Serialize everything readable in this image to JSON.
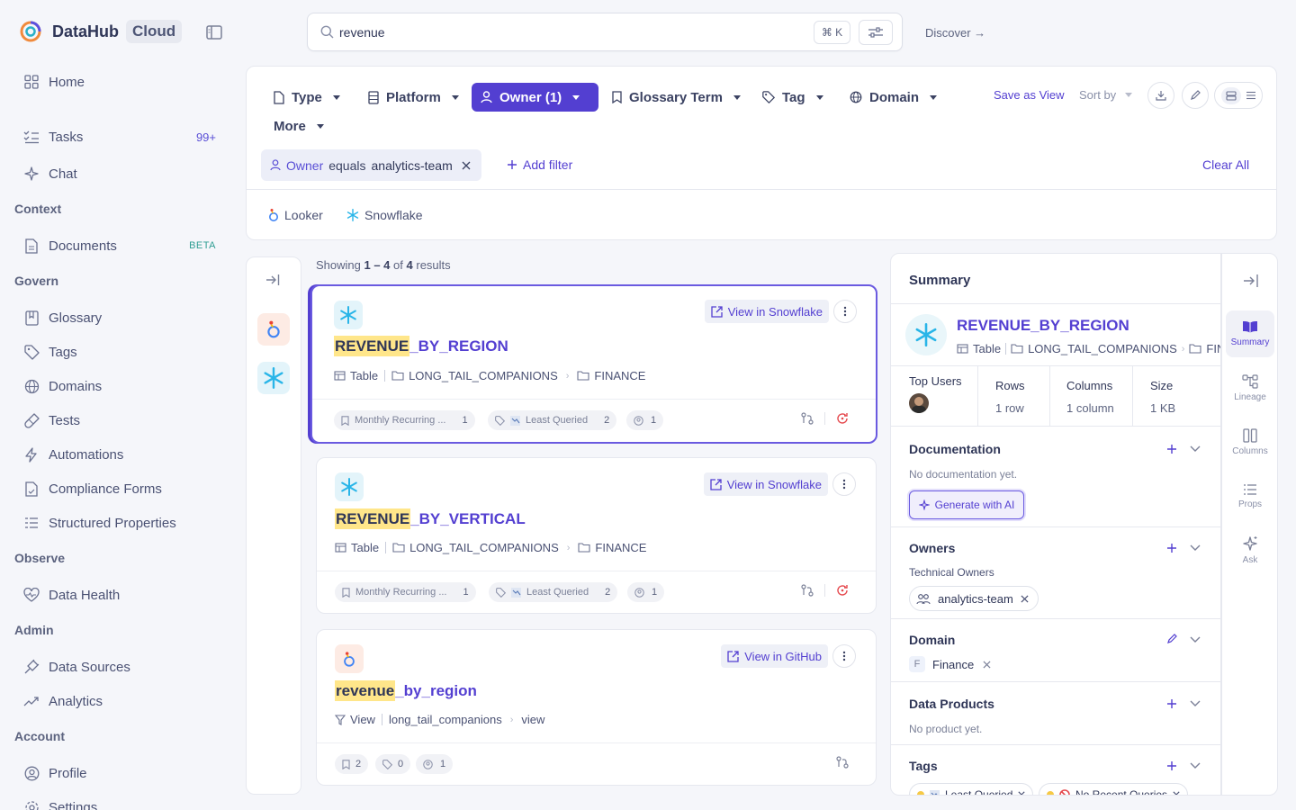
{
  "brand": {
    "name": "DataHub",
    "edition": "Cloud"
  },
  "nav": {
    "home": "Home",
    "tasks": "Tasks",
    "tasks_badge": "99+",
    "chat": "Chat",
    "context_section": "Context",
    "documents": "Documents",
    "documents_badge": "BETA",
    "govern_section": "Govern",
    "glossary": "Glossary",
    "tags": "Tags",
    "domains": "Domains",
    "tests": "Tests",
    "automations": "Automations",
    "compliance_forms": "Compliance Forms",
    "structured_properties": "Structured Properties",
    "observe_section": "Observe",
    "data_health": "Data Health",
    "admin_section": "Admin",
    "data_sources": "Data Sources",
    "analytics": "Analytics",
    "account_section": "Account",
    "profile": "Profile",
    "settings": "Settings"
  },
  "search": {
    "query": "revenue",
    "shortcut": "⌘ K"
  },
  "discover": "Discover →",
  "filters": {
    "type": "Type",
    "platform": "Platform",
    "owner": "Owner (1)",
    "glossary_term": "Glossary Term",
    "tag": "Tag",
    "domain": "Domain",
    "more": "More",
    "save_as_view": "Save as View",
    "sort_by": "Sort by",
    "active_filter": {
      "key": "Owner",
      "op": "equals",
      "value": "analytics-team"
    },
    "add_filter": "Add filter",
    "clear_all": "Clear All",
    "quick_platforms": [
      "Looker",
      "Snowflake"
    ]
  },
  "results": {
    "showing_prefix": "Showing",
    "range": "1 – 4",
    "of": "of",
    "total": "4",
    "suffix": "results",
    "items": [
      {
        "title_highlight": "REVENUE",
        "title_rest": "_BY_REGION",
        "view_label": "View in Snowflake",
        "type": "Table",
        "container": "LONG_TAIL_COMPANIONS",
        "folder": "FINANCE",
        "term": "Monthly Recurring ...",
        "term_count": "1",
        "tag": "Least Queried",
        "tag_count": "2",
        "owner_count": "1"
      },
      {
        "title_highlight": "REVENUE",
        "title_rest": "_BY_VERTICAL",
        "view_label": "View in Snowflake",
        "type": "Table",
        "container": "LONG_TAIL_COMPANIONS",
        "folder": "FINANCE",
        "term": "Monthly Recurring ...",
        "term_count": "1",
        "tag": "Least Queried",
        "tag_count": "2",
        "owner_count": "1"
      },
      {
        "title_highlight": "revenue",
        "title_rest": "_by_region",
        "view_label": "View in GitHub",
        "type": "View",
        "container": "long_tail_companions",
        "folder": "view",
        "term_count": "2",
        "tag_count": "0",
        "owner_count": "1"
      }
    ]
  },
  "summary": {
    "header": "Summary",
    "name": "REVENUE_BY_REGION",
    "type": "Table",
    "container": "LONG_TAIL_COMPANIONS",
    "folder_truncated": "FIN",
    "top_users_label": "Top Users",
    "rows_label": "Rows",
    "rows_value": "1 row",
    "columns_label": "Columns",
    "columns_value": "1 column",
    "size_label": "Size",
    "size_value": "1 KB",
    "documentation_title": "Documentation",
    "documentation_note": "No documentation yet.",
    "generate_ai": "Generate with AI",
    "owners_title": "Owners",
    "owners_subtitle": "Technical Owners",
    "owner_name": "analytics-team",
    "domain_title": "Domain",
    "domain_letter": "F",
    "domain_name": "Finance",
    "data_products_title": "Data Products",
    "data_products_note": "No product yet.",
    "tags_title": "Tags",
    "tags": [
      "Least Queried",
      "No Recent Queries"
    ]
  },
  "tabs": {
    "summary": "Summary",
    "lineage": "Lineage",
    "columns": "Columns",
    "props": "Props",
    "ask": "Ask"
  },
  "colors": {
    "accent": "#533fd1",
    "highlight": "#ffe68a",
    "snowflake": "#29b5e8",
    "looker_bg": "#fdebe4",
    "error": "#e5484d"
  }
}
